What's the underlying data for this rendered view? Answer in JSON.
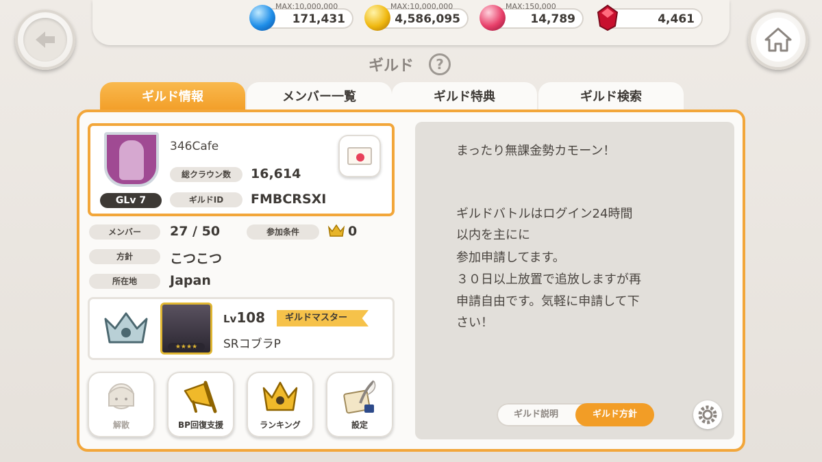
{
  "resources": [
    {
      "icon": "blue-orb-icon",
      "max": "MAX:10,000,000",
      "value": "171,431"
    },
    {
      "icon": "gold-orb-icon",
      "max": "MAX:10,000,000",
      "value": "4,586,095"
    },
    {
      "icon": "pink-orb-icon",
      "max": "MAX:150,000",
      "value": "14,789"
    },
    {
      "icon": "red-gem-icon",
      "max": "",
      "value": "4,461"
    }
  ],
  "header": {
    "title": "ギルド",
    "help": "?"
  },
  "tabs": [
    "ギルド情報",
    "メンバー一覧",
    "ギルド特典",
    "ギルド検索"
  ],
  "guild": {
    "name": "346Cafe",
    "level": "GLv 7",
    "crowns_label": "総クラウン数",
    "crowns": "16,614",
    "id_label": "ギルドID",
    "id": "FMBCRSXI",
    "members_label": "メンバー",
    "members": "27 / 50",
    "join_label": "参加条件",
    "join_value": "0",
    "policy_label": "方針",
    "policy": "こつこつ",
    "location_label": "所在地",
    "location": "Japan"
  },
  "master": {
    "level_prefix": "Lv",
    "level": "108",
    "tag": "ギルドマスター",
    "name": "SRコブラP",
    "stars": "★★★★"
  },
  "actions": [
    {
      "label": "解散",
      "icon": "character-icon",
      "enabled": false
    },
    {
      "label": "BP回復支援",
      "icon": "megaphone-icon",
      "enabled": true
    },
    {
      "label": "ランキング",
      "icon": "crown-icon",
      "enabled": true
    },
    {
      "label": "設定",
      "icon": "quill-paper-icon",
      "enabled": true
    }
  ],
  "description": [
    "まったり無課金勢カモーン！",
    "",
    "",
    "ギルドバトルはログイン24時間",
    "以内を主にに",
    "参加申請してます。",
    "３０日以上放置で追放しますが再",
    "申請自由です。気軽に申請して下",
    "さい！"
  ],
  "toggle": {
    "left": "ギルド説明",
    "right": "ギルド方針"
  },
  "colors": {
    "accent": "#f29d26",
    "border": "#f2a63a",
    "text": "#3d3935"
  }
}
